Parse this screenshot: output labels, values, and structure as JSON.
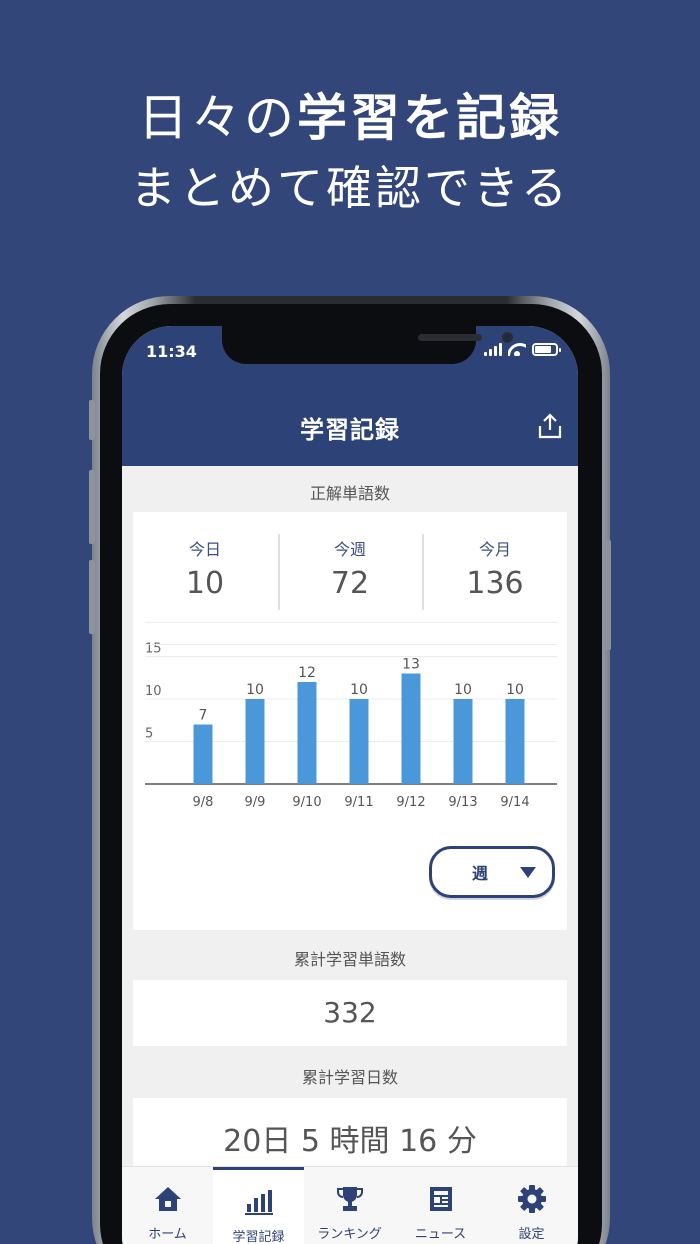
{
  "headline": {
    "line1_plain": "日々の",
    "line1_bold": "学習を記録",
    "line2": "まとめて確認できる"
  },
  "status_bar": {
    "time": "11:34"
  },
  "screen": {
    "title": "学習記録",
    "share_icon": "share-icon"
  },
  "correct_words": {
    "label": "正解単語数",
    "stats": [
      {
        "label": "今日",
        "value": "10"
      },
      {
        "label": "今週",
        "value": "72"
      },
      {
        "label": "今月",
        "value": "136"
      }
    ]
  },
  "chart_data": {
    "type": "bar",
    "categories": [
      "9/8",
      "9/9",
      "9/10",
      "9/11",
      "9/12",
      "9/13",
      "9/14"
    ],
    "values": [
      7,
      10,
      12,
      10,
      13,
      10,
      10
    ],
    "yticks": [
      5,
      10,
      15
    ],
    "ylim": [
      0,
      16
    ],
    "grid": true,
    "bar_color": "#4a98d9"
  },
  "period_select": {
    "value": "週"
  },
  "cumulative_words": {
    "label": "累計学習単語数",
    "value": "332"
  },
  "cumulative_days": {
    "label": "累計学習日数",
    "days": "20",
    "days_unit": "日",
    "hours": "5",
    "hours_unit": "時間",
    "minutes": "16",
    "minutes_unit": "分"
  },
  "tabs": [
    {
      "label": "ホーム",
      "icon": "home-icon",
      "active": false
    },
    {
      "label": "学習記録",
      "icon": "bar-chart-icon",
      "active": true
    },
    {
      "label": "ランキング",
      "icon": "trophy-icon",
      "active": false
    },
    {
      "label": "ニュース",
      "icon": "newspaper-icon",
      "active": false
    },
    {
      "label": "設定",
      "icon": "gear-icon",
      "active": false
    }
  ],
  "colors": {
    "background": "#33467a",
    "app_bar": "#2d4276",
    "bar": "#4a98d9"
  }
}
